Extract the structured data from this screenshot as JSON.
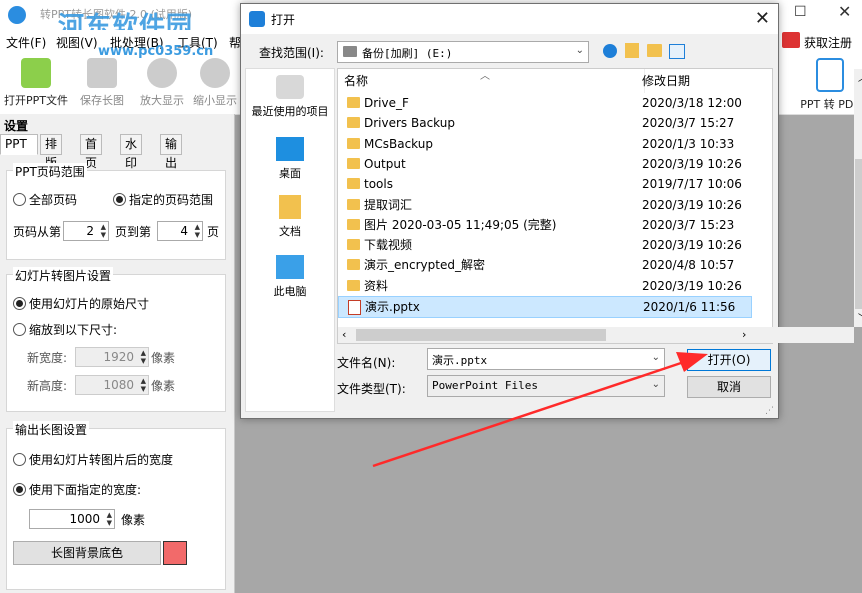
{
  "app": {
    "title": "转PPT转长图软件 2.0 (试用版)",
    "watermark_main": "河东软件园",
    "watermark_url": "www.pc0359.cn",
    "menus": [
      "文件(F)",
      "视图(V)",
      "批处理(B)",
      "工具(T)",
      "帮"
    ],
    "register": "获取注册码",
    "toolbar": {
      "open": "打开PPT文件",
      "save": "保存长图",
      "zoom_in": "放大显示",
      "zoom_out": "缩小显示",
      "ppt_to_pdf": "PPT 转 PDF"
    }
  },
  "settings": {
    "title": "设置",
    "tabs": [
      "PPT",
      "排版",
      "首页",
      "水印",
      "输出"
    ],
    "page_range": {
      "title": "PPT页码范围",
      "all": "全部页码",
      "specified": "指定的页码范围",
      "from_label": "页码从第",
      "from_value": "2",
      "to_label": "页到第",
      "to_value": "4",
      "page_unit": "页"
    },
    "slide_image": {
      "title": "幻灯片转图片设置",
      "original": "使用幻灯片的原始尺寸",
      "scale": "缩放到以下尺寸:",
      "width_label": "新宽度:",
      "width_value": "1920",
      "height_label": "新高度:",
      "height_value": "1080",
      "unit": "像素"
    },
    "output": {
      "title": "输出长图设置",
      "use_slide_width": "使用幻灯片转图片后的宽度",
      "use_specified": "使用下面指定的宽度:",
      "width_value": "1000",
      "unit": "像素",
      "bg_button": "长图背景底色",
      "bg_color": "#f26a6a"
    }
  },
  "dialog": {
    "title": "打开",
    "look_in_label": "查找范围(I):",
    "look_in_value": "备份[加刷] (E:)",
    "places": [
      "最近使用的项目",
      "桌面",
      "文档",
      "此电脑"
    ],
    "columns": {
      "name": "名称",
      "modified": "修改日期"
    },
    "files": [
      {
        "name": "Drive_F",
        "date": "2020/3/18 12:00",
        "type": "folder"
      },
      {
        "name": "Drivers Backup",
        "date": "2020/3/7 15:27",
        "type": "folder"
      },
      {
        "name": "MCsBackup",
        "date": "2020/1/3 10:33",
        "type": "folder"
      },
      {
        "name": "Output",
        "date": "2020/3/19 10:26",
        "type": "folder"
      },
      {
        "name": "tools",
        "date": "2019/7/17 10:06",
        "type": "folder"
      },
      {
        "name": "提取词汇",
        "date": "2020/3/19 10:26",
        "type": "folder"
      },
      {
        "name": "图片 2020-03-05 11;49;05 (完整)",
        "date": "2020/3/7 15:23",
        "type": "folder"
      },
      {
        "name": "下载视频",
        "date": "2020/3/19 10:26",
        "type": "folder"
      },
      {
        "name": "演示_encrypted_解密",
        "date": "2020/4/8 10:57",
        "type": "folder"
      },
      {
        "name": "资料",
        "date": "2020/3/19 10:26",
        "type": "folder"
      },
      {
        "name": "演示.pptx",
        "date": "2020/1/6 11:56",
        "type": "pptx"
      }
    ],
    "filename_label": "文件名(N):",
    "filename_value": "演示.pptx",
    "filetype_label": "文件类型(T):",
    "filetype_value": "PowerPoint Files",
    "open_button": "打开(O)",
    "cancel_button": "取消"
  },
  "colors": {
    "accent_blue": "#1e7fd8",
    "arrow_red": "#ff2a2a",
    "folder_yellow": "#f2c14e",
    "selection": "#cce8ff"
  }
}
